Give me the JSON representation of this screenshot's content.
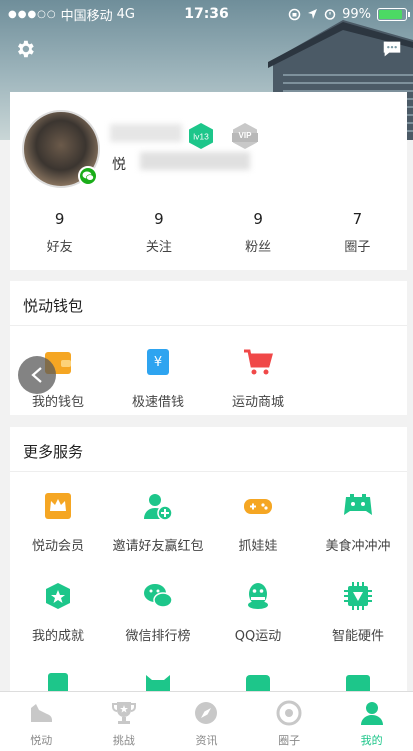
{
  "statusbar": {
    "carrier": "中国移动",
    "network": "4G",
    "time": "17:36",
    "battery": "99%",
    "signal_dots": "●●●○○"
  },
  "profile": {
    "nickname_prefix": "悦",
    "level_badge": "lv13",
    "vip_badge": "VIP",
    "stats": [
      {
        "value": "9",
        "label": "好友"
      },
      {
        "value": "9",
        "label": "关注"
      },
      {
        "value": "9",
        "label": "粉丝"
      },
      {
        "value": "7",
        "label": "圈子"
      }
    ]
  },
  "wallet": {
    "title": "悦动钱包",
    "items": [
      {
        "label": "我的钱包",
        "icon": "wallet-icon"
      },
      {
        "label": "极速借钱",
        "icon": "yen-card-icon"
      },
      {
        "label": "运动商城",
        "icon": "shopping-cart-icon"
      }
    ]
  },
  "services": {
    "title": "更多服务",
    "items": [
      {
        "label": "悦动会员",
        "icon": "crown-icon"
      },
      {
        "label": "邀请好友赢红包",
        "icon": "add-friend-icon"
      },
      {
        "label": "抓娃娃",
        "icon": "gamepad-icon"
      },
      {
        "label": "美食冲冲冲",
        "icon": "game-controller-icon"
      },
      {
        "label": "我的成就",
        "icon": "medal-icon"
      },
      {
        "label": "微信排行榜",
        "icon": "wechat-icon"
      },
      {
        "label": "QQ运动",
        "icon": "qq-icon"
      },
      {
        "label": "智能硬件",
        "icon": "chip-icon"
      }
    ]
  },
  "tabbar": {
    "tabs": [
      {
        "label": "悦动",
        "icon": "shoe-icon"
      },
      {
        "label": "挑战",
        "icon": "trophy-icon"
      },
      {
        "label": "资讯",
        "icon": "compass-icon"
      },
      {
        "label": "圈子",
        "icon": "circle-icon"
      },
      {
        "label": "我的",
        "icon": "person-icon"
      }
    ],
    "active_color": "#1dc68a"
  },
  "colors": {
    "accent_green": "#1dc68a",
    "wallet_orange": "#f5a623",
    "cart_red": "#f04848",
    "loan_blue": "#2ea4f0"
  }
}
